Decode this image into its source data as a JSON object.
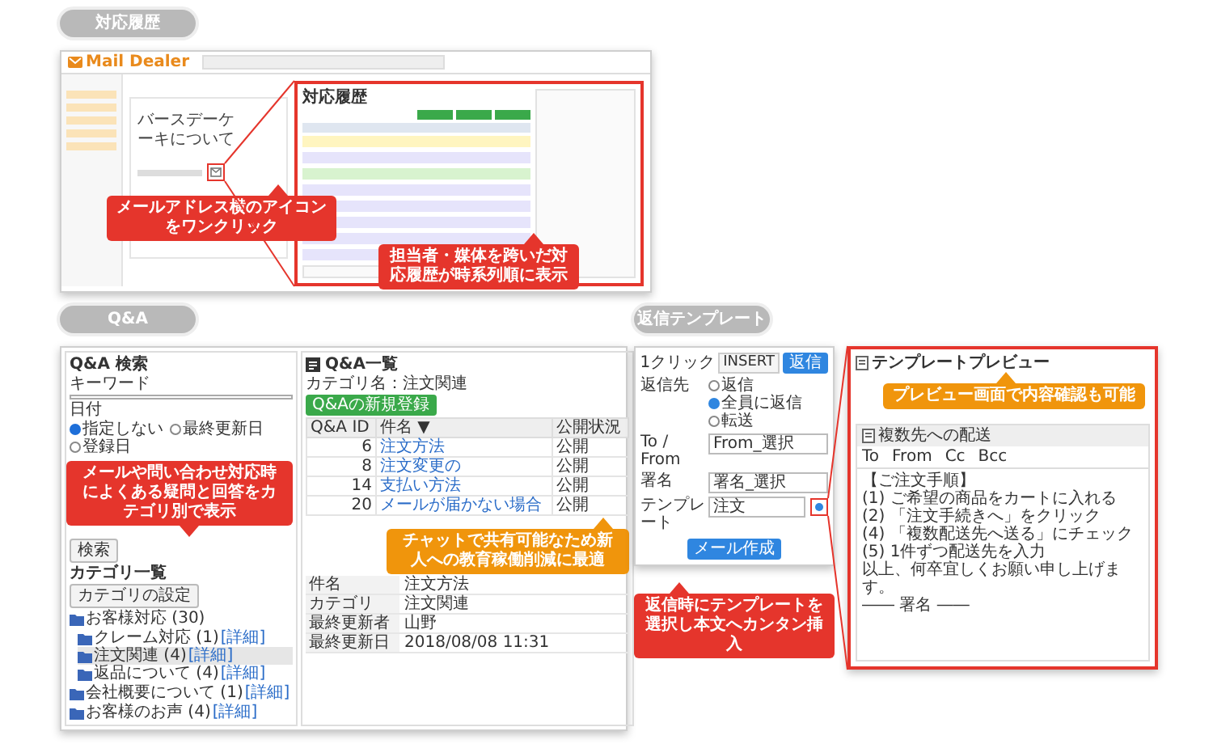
{
  "history": {
    "label": "対応履歴",
    "logo": "Mail Dealer",
    "subject": "バースデーケーキについて",
    "panel_title": "対応履歴",
    "rows": [
      {
        "color": "#fff5c0"
      },
      {
        "color": "#e6e4fb"
      },
      {
        "color": "#d8f3cf"
      },
      {
        "color": "#e6e4fb"
      },
      {
        "color": "#e6e4fb"
      },
      {
        "color": "#e6e4fb"
      },
      {
        "color": "#e6e4fb"
      },
      {
        "color": "#e6e4fb"
      }
    ],
    "callouts": [
      {
        "text": "メールアドレス横のアイコンをワンクリック",
        "color": "#e5352c"
      },
      {
        "text": "担当者・媒体を跨いだ対応履歴が時系列順に表示",
        "color": "#e5352c"
      }
    ]
  },
  "qa": {
    "label": "Q&A",
    "search_title": "Q&A 検索",
    "keyword_label": "キーワード",
    "date_label": "日付",
    "date_options": [
      {
        "label": "指定しない",
        "selected": true
      },
      {
        "label": "最終更新日",
        "selected": false
      },
      {
        "label": "登録日",
        "selected": false
      }
    ],
    "search_button": "検索",
    "category_title": "カテゴリ一覧",
    "category_button": "カテゴリの設定",
    "tree": [
      {
        "label": "お客様対応",
        "count": "(30)",
        "selected": false,
        "children": [
          {
            "label": "クレーム対応",
            "count": "(1)",
            "link": "[詳細]",
            "selected": false
          },
          {
            "label": "注文関連",
            "count": "(4)",
            "link": "[詳細]",
            "selected": true
          },
          {
            "label": "返品について",
            "count": "(4)",
            "link": "[詳細]",
            "selected": false
          }
        ]
      },
      {
        "label": "会社概要について",
        "count": "(1)",
        "link": "[詳細]",
        "selected": false
      },
      {
        "label": "お客様のお声",
        "count": "(4)",
        "link": "[詳細]",
        "selected": false
      }
    ],
    "list_title": "Q&A一覧",
    "category_name": "カテゴリ名：注文関連",
    "new_button": "Q&Aの新規登録",
    "columns": [
      "Q&A ID",
      "件名 ▼",
      "公開状況"
    ],
    "rows": [
      [
        "6",
        "注文方法",
        "公開"
      ],
      [
        "8",
        "注文変更の",
        "公開"
      ],
      [
        "14",
        "支払い方法",
        "公開"
      ],
      [
        "20",
        "メールが届かない場合",
        "公開"
      ]
    ],
    "detail": [
      {
        "label": "件名",
        "value": "注文方法"
      },
      {
        "label": "カテゴリ",
        "value": "注文関連"
      },
      {
        "label": "最終更新者",
        "value": "山野"
      },
      {
        "label": "最終更新日",
        "value": "2018/08/08 11:31"
      }
    ],
    "callouts": [
      {
        "text": "メールや問い合わせ対応時によくある疑問と回答をカテゴリ別で表示",
        "color": "#e5352c"
      },
      {
        "text": "チャットで共有可能なため新人への教育稼働削減に最適",
        "color": "#f0950c"
      }
    ]
  },
  "template": {
    "label": "返信テンプレート",
    "one_click": "1クリック",
    "insert": "INSERT",
    "reply_button": "返信",
    "rows": [
      {
        "label": "返信先",
        "kind": "radio",
        "options": [
          {
            "label": "返信",
            "selected": false
          },
          {
            "label": "全員に返信",
            "selected": true
          },
          {
            "label": "転送",
            "selected": false
          }
        ]
      },
      {
        "label": "To / From",
        "kind": "select",
        "value": "From_選択"
      },
      {
        "label": "署名",
        "kind": "select",
        "value": "署名_選択"
      },
      {
        "label": "テンプレート",
        "kind": "template",
        "value": "注文"
      }
    ],
    "compose_button": "メール作成",
    "callout": {
      "text": "返信時にテンプレートを選択し本文へカンタン挿入",
      "color": "#e5352c"
    }
  },
  "preview": {
    "title": "テンプレートプレビュー",
    "template_name": "複数先への配送",
    "headers": [
      "To",
      "From",
      "Cc",
      "Bcc"
    ],
    "body": [
      "【ご注文手順】",
      "(1) ご希望の商品をカートに入れる",
      "(2) 「注文手続きへ」をクリック",
      "(4) 「複数配送先へ送る」にチェック",
      "(5) 1件ずつ配送先を入力",
      "以上、何卒宜しくお願い申し上げます。",
      "―― 署名 ――"
    ],
    "callout": {
      "text": "プレビュー画面で内容確認も可能",
      "color": "#f0950c"
    }
  }
}
